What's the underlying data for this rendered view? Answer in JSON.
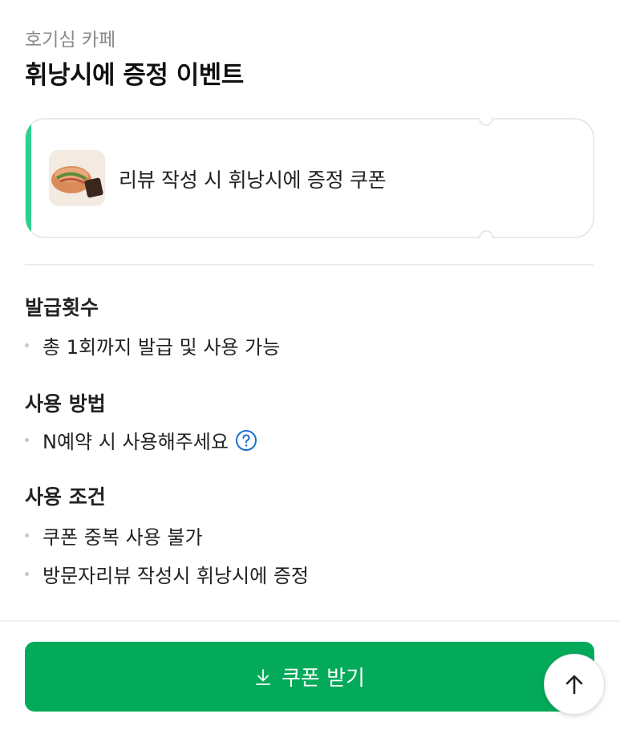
{
  "header": {
    "store_name": "호기심 카페",
    "event_title": "휘낭시에 증정 이벤트"
  },
  "coupon": {
    "name": "리뷰 작성 시 휘낭시에 증정 쿠폰",
    "accent_color": "#2dd08c"
  },
  "sections": [
    {
      "title": "발급횟수",
      "items": [
        "총 1회까지 발급 및 사용 가능"
      ]
    },
    {
      "title": "사용 방법",
      "items": [
        "N예약 시 사용해주세요"
      ]
    },
    {
      "title": "사용 조건",
      "items": [
        "쿠폰 중복 사용 불가",
        "방문자리뷰 작성시 휘낭시에 증정"
      ]
    }
  ],
  "actions": {
    "download_label": "쿠폰 받기",
    "download_icon": "download-icon",
    "scroll_top_icon": "arrow-up-icon",
    "help_icon": "question-circle-icon",
    "primary_color": "#03aa5a",
    "help_color": "#1a6fd0"
  }
}
